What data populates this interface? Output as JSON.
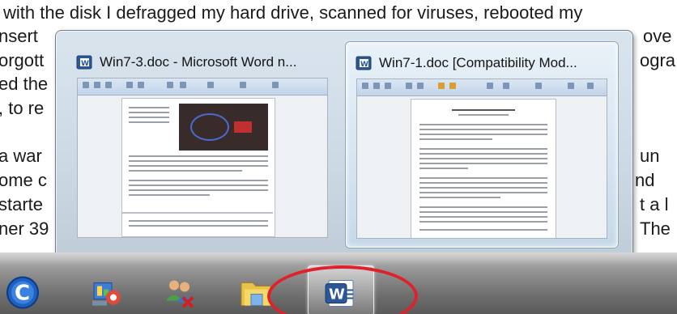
{
  "background_text": {
    "lines": [
      "with the disk I defragged my hard drive, scanned for viruses, rebooted my",
      "nsert",
      "orgott",
      "ed the",
      ", to re",
      "a war",
      "ome c",
      "starte",
      "ner 39"
    ],
    "right_fragments": [
      "ove",
      "ogra",
      "un",
      "nd",
      "t a l",
      "The"
    ]
  },
  "peek": {
    "windows": [
      {
        "title": "Win7-3.doc - Microsoft Word n...",
        "selected": false
      },
      {
        "title": "Win7-1.doc [Compatibility Mod...",
        "selected": true
      }
    ]
  },
  "taskbar": {
    "buttons": [
      {
        "icon": "ccleaner-icon",
        "active": false
      },
      {
        "icon": "control-panel-icon",
        "active": false
      },
      {
        "icon": "user-accounts-icon",
        "active": false
      },
      {
        "icon": "windows-explorer-icon",
        "active": false
      },
      {
        "icon": "microsoft-word-icon",
        "active": true
      }
    ]
  },
  "colors": {
    "annotation_circle": "#e0202a",
    "word_blue": "#2b5797"
  }
}
